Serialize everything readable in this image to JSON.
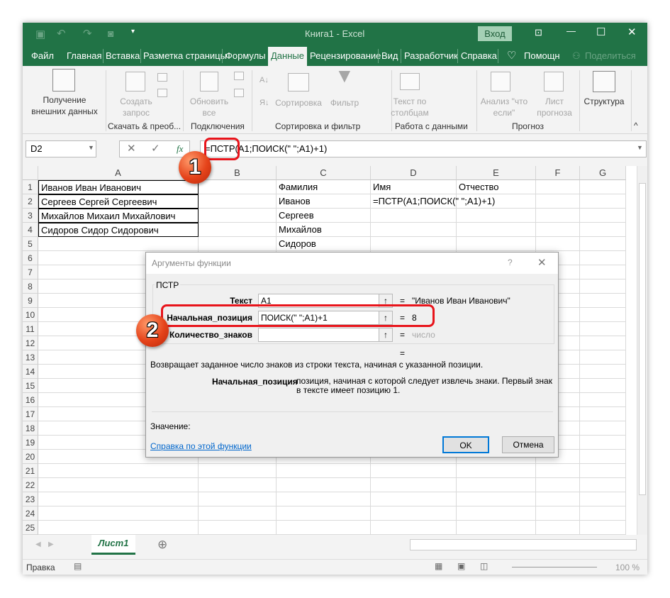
{
  "titlebar": {
    "title": "Книга1  -  Excel",
    "signin": "Вход"
  },
  "tabs": [
    "Файл",
    "Главная",
    "Вставка",
    "Разметка страницы",
    "Формулы",
    "Данные",
    "Рецензирование",
    "Вид",
    "Разработчик",
    "Справка"
  ],
  "active_tab": "Данные",
  "help_search": "Помощн",
  "share": "Поделиться",
  "ribbon": {
    "get_external": "Получение внешних данных",
    "new_query": "Создать запрос",
    "group1": "Скачать & преоб...",
    "refresh_all": "Обновить все",
    "group2": "Подключения",
    "sort": "Сортировка",
    "filter": "Фильтр",
    "group3": "Сортировка и фильтр",
    "text_to_columns": "Текст по столбцам",
    "group4": "Работа с данными",
    "what_if": "Анализ \"что если\"",
    "forecast_sheet": "Лист прогноза",
    "group5": "Прогноз",
    "outline": "Структура"
  },
  "formula_bar": {
    "name_box": "D2",
    "formula": "=ПСТР(A1;ПОИСК(\" \";A1)+1)",
    "fx": "fx"
  },
  "columns": [
    "A",
    "B",
    "C",
    "D",
    "E",
    "F",
    "G"
  ],
  "rows": [
    [
      "Иванов Иван Иванович",
      "",
      "Фамилия",
      "Имя",
      "Отчество",
      "",
      ""
    ],
    [
      "Сергеев Сергей Сергеевич",
      "",
      "Иванов",
      "=ПСТР(A1;ПОИСК(\" \";A1)+1)",
      "",
      "",
      ""
    ],
    [
      "Михайлов Михаил Михайлович",
      "",
      "Сергеев",
      "",
      "",
      "",
      ""
    ],
    [
      "Сидоров Сидор Сидорович",
      "",
      "Михайлов",
      "",
      "",
      "",
      ""
    ],
    [
      "",
      "",
      "Сидоров",
      "",
      "",
      "",
      ""
    ]
  ],
  "row_count": 25,
  "dialog": {
    "title": "Аргументы функции",
    "help_q": "?",
    "func": "ПСТР",
    "args": [
      {
        "label": "Текст",
        "value": "A1",
        "result": "\"Иванов Иван Иванович\""
      },
      {
        "label": "Начальная_позиция",
        "value": "ПОИСК(\" \";A1)+1",
        "result": "8"
      },
      {
        "label": "Количество_знаков",
        "value": "",
        "result": "число"
      }
    ],
    "eq": "=",
    "description": "Возвращает заданное число знаков из строки текста, начиная с указанной позиции.",
    "arg_name": "Начальная_позиция",
    "arg_desc": "позиция, начиная с которой следует извлечь знаки. Первый знак в тексте имеет позицию 1.",
    "value_label": "Значение:",
    "help_link": "Справка по этой функции",
    "ok": "OK",
    "cancel": "Отмена"
  },
  "callouts": [
    "1",
    "2"
  ],
  "sheet_tab": "Лист1",
  "status": {
    "mode": "Правка",
    "zoom": "100 %"
  },
  "colors": {
    "excel_green": "#217346",
    "highlight": "#e8141b"
  }
}
